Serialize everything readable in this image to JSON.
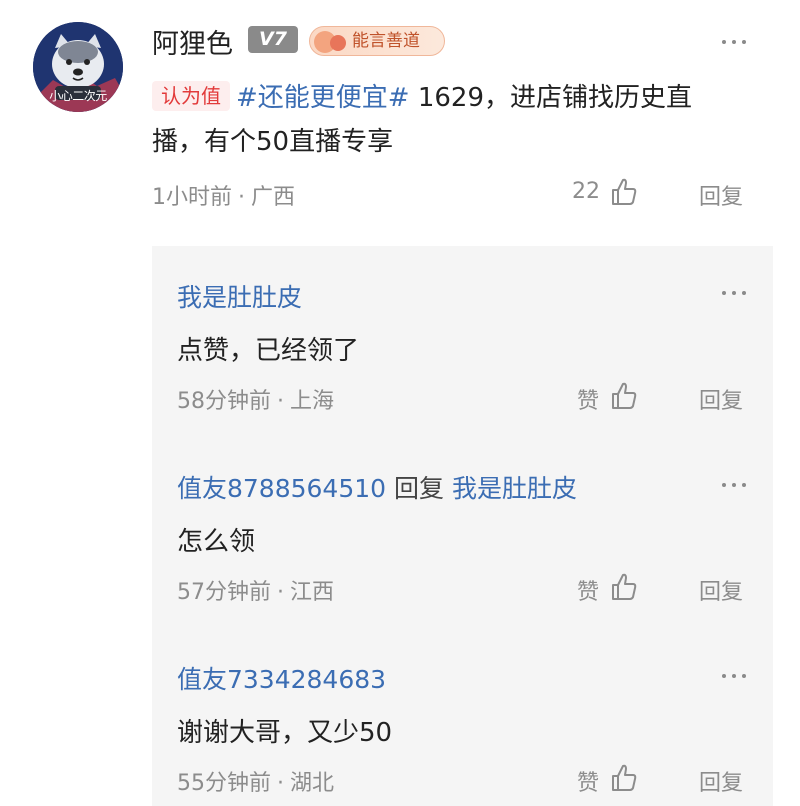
{
  "post": {
    "avatar_caption": "小心二次元",
    "username": "阿狸色",
    "level": "V7",
    "medal": "能言善道",
    "tag": "认为值",
    "topic": "#还能更便宜#",
    "text_line1": " 1629，进店铺找历史直",
    "text_line2": "播，有个50直播专享",
    "time": "1小时前",
    "location": "广西",
    "like_count": "22",
    "reply_label": "回复"
  },
  "replies": [
    {
      "user": "我是肚肚皮",
      "text": "点赞，已经领了",
      "time": "58分钟前",
      "location": "上海",
      "like_label": "赞",
      "reply_label": "回复"
    },
    {
      "user": "值友8788564510",
      "reply_word": "回复",
      "reply_to": "我是肚肚皮",
      "text": "怎么领",
      "time": "57分钟前",
      "location": "江西",
      "like_label": "赞",
      "reply_label": "回复"
    },
    {
      "user": "值友7334284683",
      "text": "谢谢大哥，又少50",
      "time": "55分钟前",
      "location": "湖北",
      "like_label": "赞",
      "reply_label": "回复"
    }
  ],
  "colors": {
    "link_blue": "#3b6db3",
    "tag_red": "#e23a3a",
    "meta_gray": "#8c8c8c",
    "reply_bg": "#f5f5f5"
  },
  "icons": [
    "more-icon",
    "thumb-up-icon",
    "medal-icon"
  ]
}
